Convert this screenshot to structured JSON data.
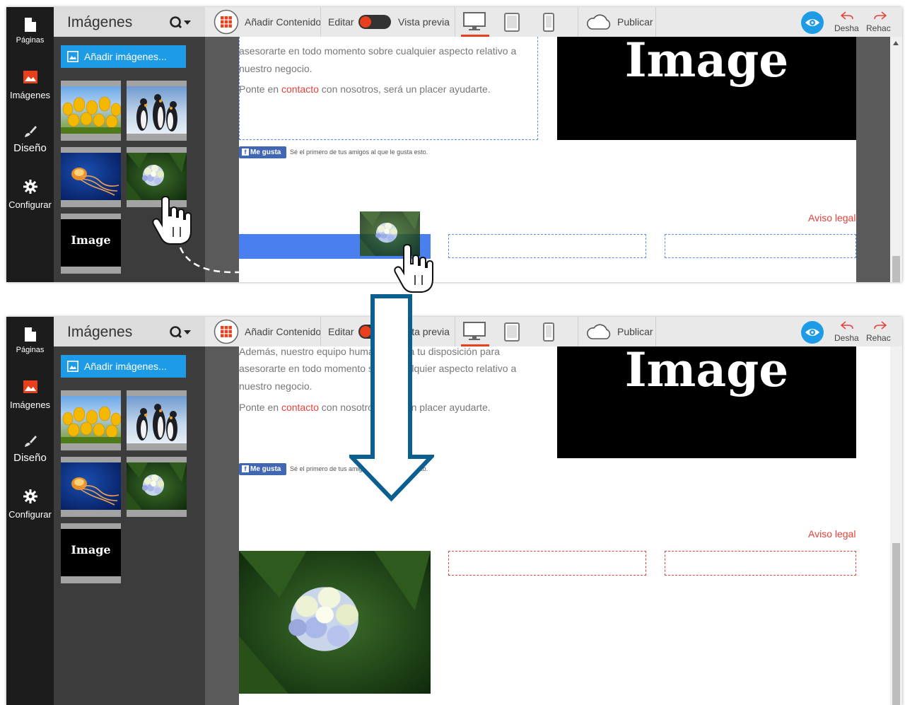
{
  "nav": {
    "pages": "Páginas",
    "images": "Imágenes",
    "design": "Diseño",
    "settings": "Configurar"
  },
  "images_panel": {
    "title": "Imágenes",
    "add_button": "Añadir imágenes...",
    "thumbnails": [
      "tulips",
      "penguins",
      "jellyfish",
      "hydrangea",
      "image-placeholder"
    ],
    "placeholder_text": "Image"
  },
  "toolbar": {
    "add_content": "Añadir Contenido",
    "edit": "Editar",
    "preview": "Vista previa",
    "publish": "Publicar",
    "undo": "Desha",
    "redo": "Rehac"
  },
  "page": {
    "text_top": "Además, nuestro equipo humano está a tu disposición para",
    "text_1": "asesorarte en todo momento sobre cualquier aspecto relativo a",
    "text_2": "nuestro negocio.",
    "contact_pre": "Ponte en",
    "contact_link": "contacto",
    "contact_post": "con nosotros, será un placer ayudarte.",
    "fb_button": "Me gusta",
    "fb_text": "Sé el primero de tus amigos al que le gusta esto.",
    "image_label": "Image",
    "legal": "Aviso legal"
  },
  "icons": [
    "file-icon",
    "image-icon",
    "brush-icon",
    "gear-icon",
    "search-icon",
    "grid-icon",
    "toggle-icon",
    "desktop-icon",
    "tablet-icon",
    "phone-icon",
    "cloud-icon",
    "eye-icon",
    "undo-icon",
    "redo-icon",
    "hand-cursor-icon",
    "down-arrow-icon"
  ],
  "colors": {
    "accent_blue": "#1e9be6",
    "toggle_orange": "#e8401c",
    "link_red": "#e8403a",
    "arrow_blue": "#0a5f8f"
  }
}
